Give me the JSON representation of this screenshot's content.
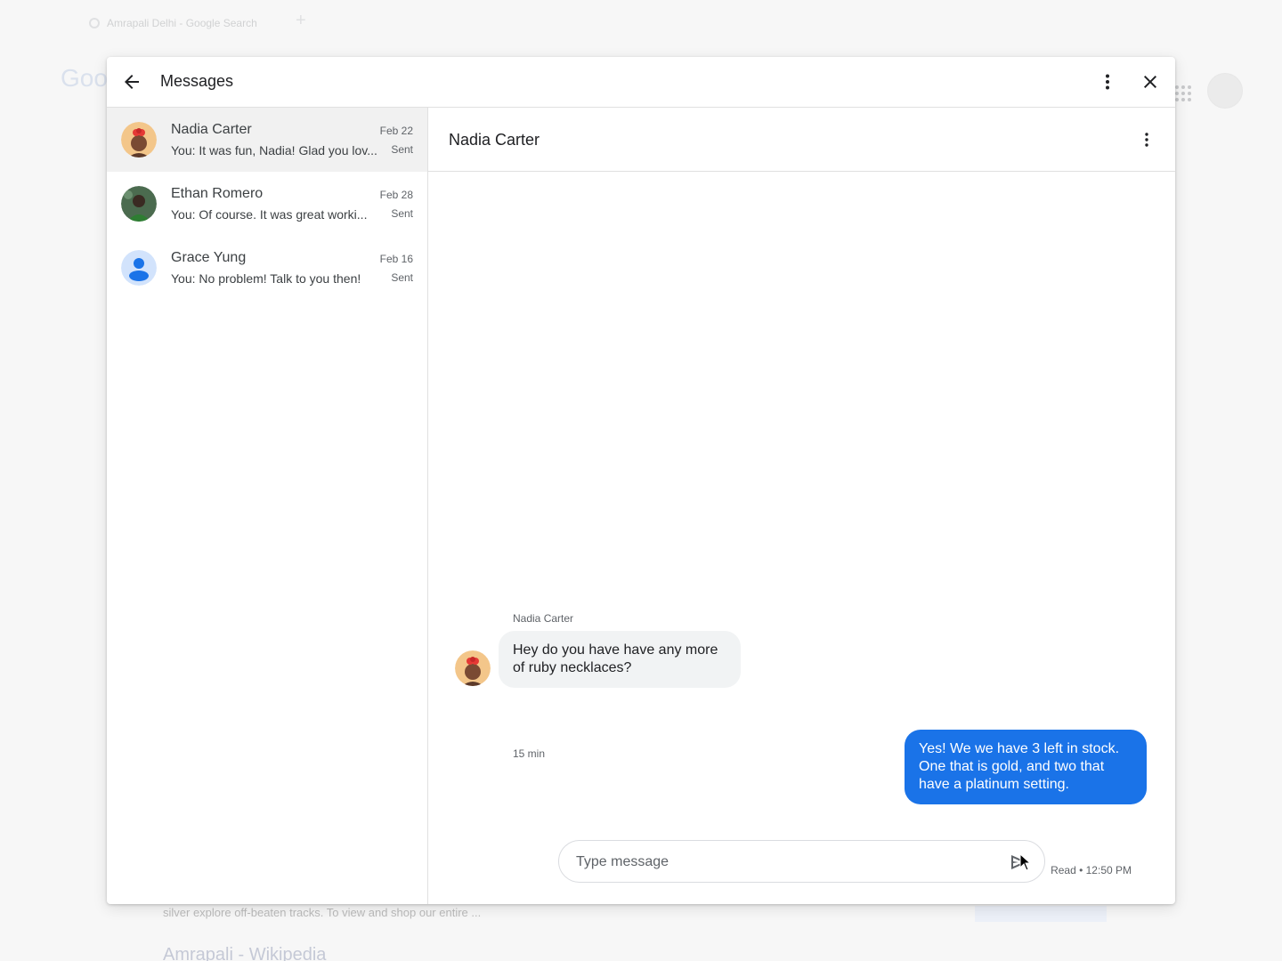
{
  "browser": {
    "tab_title": "Amrapali Delhi - Google Search",
    "logo_text": "Goo",
    "result_snippet": "silver explore off-beaten tracks. To view and shop our entire ...",
    "result_link": "Amrapali - Wikipedia"
  },
  "dialog": {
    "title": "Messages"
  },
  "conversations": [
    {
      "name": "Nadia Carter",
      "snippet": "You: It was fun, Nadia! Glad you lov...",
      "date": "Feb 22",
      "status": "Sent",
      "selected": true
    },
    {
      "name": "Ethan Romero",
      "snippet": "You: Of course. It was great worki...",
      "date": "Feb 28",
      "status": "Sent",
      "selected": false
    },
    {
      "name": "Grace Yung",
      "snippet": "You: No problem! Talk to you then!",
      "date": "Feb 16",
      "status": "Sent",
      "selected": false
    }
  ],
  "chat": {
    "title": "Nadia Carter",
    "incoming": {
      "sender": "Nadia Carter",
      "text": "Hey do you have have any more of ruby necklaces?",
      "time": "15 min"
    },
    "outgoing": {
      "text": "Yes! We we have 3 left in stock. One that is gold, and two that have a platinum setting.",
      "status": "Read • 12:50 PM"
    },
    "composer": {
      "placeholder": "Type message"
    }
  },
  "colors": {
    "accent": "#1a73e8",
    "incoming_bubble": "#f1f3f4",
    "selected_row": "#f1f1f1"
  }
}
